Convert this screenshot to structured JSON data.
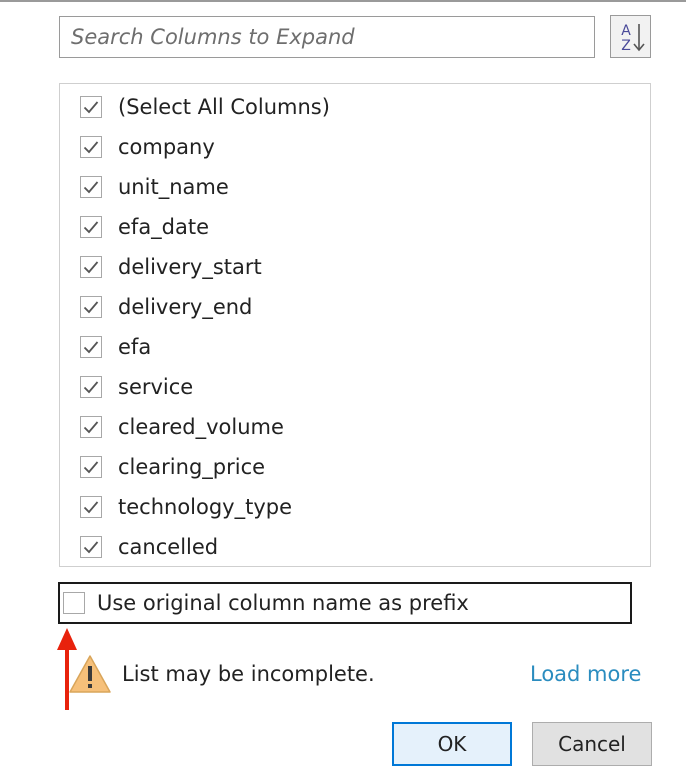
{
  "search": {
    "placeholder": "Search Columns to Expand",
    "value": ""
  },
  "sort_button": {
    "icon": "sort-az-icon",
    "top": "A",
    "bottom": "Z"
  },
  "columns": [
    {
      "label": "(Select All Columns)",
      "checked": true
    },
    {
      "label": "company",
      "checked": true
    },
    {
      "label": "unit_name",
      "checked": true
    },
    {
      "label": "efa_date",
      "checked": true
    },
    {
      "label": "delivery_start",
      "checked": true
    },
    {
      "label": "delivery_end",
      "checked": true
    },
    {
      "label": "efa",
      "checked": true
    },
    {
      "label": "service",
      "checked": true
    },
    {
      "label": "cleared_volume",
      "checked": true
    },
    {
      "label": "clearing_price",
      "checked": true
    },
    {
      "label": "technology_type",
      "checked": true
    },
    {
      "label": "cancelled",
      "checked": true
    }
  ],
  "prefix_option": {
    "label": "Use original column name as prefix",
    "checked": false
  },
  "warning": {
    "icon": "warning-icon",
    "text": "List may be incomplete.",
    "link": "Load more"
  },
  "buttons": {
    "ok": "OK",
    "cancel": "Cancel"
  },
  "colors": {
    "link": "#2a8cbf",
    "ok_border": "#0078d7",
    "annotation_arrow": "#e8220c",
    "warning_fill": "#f6c07a"
  }
}
